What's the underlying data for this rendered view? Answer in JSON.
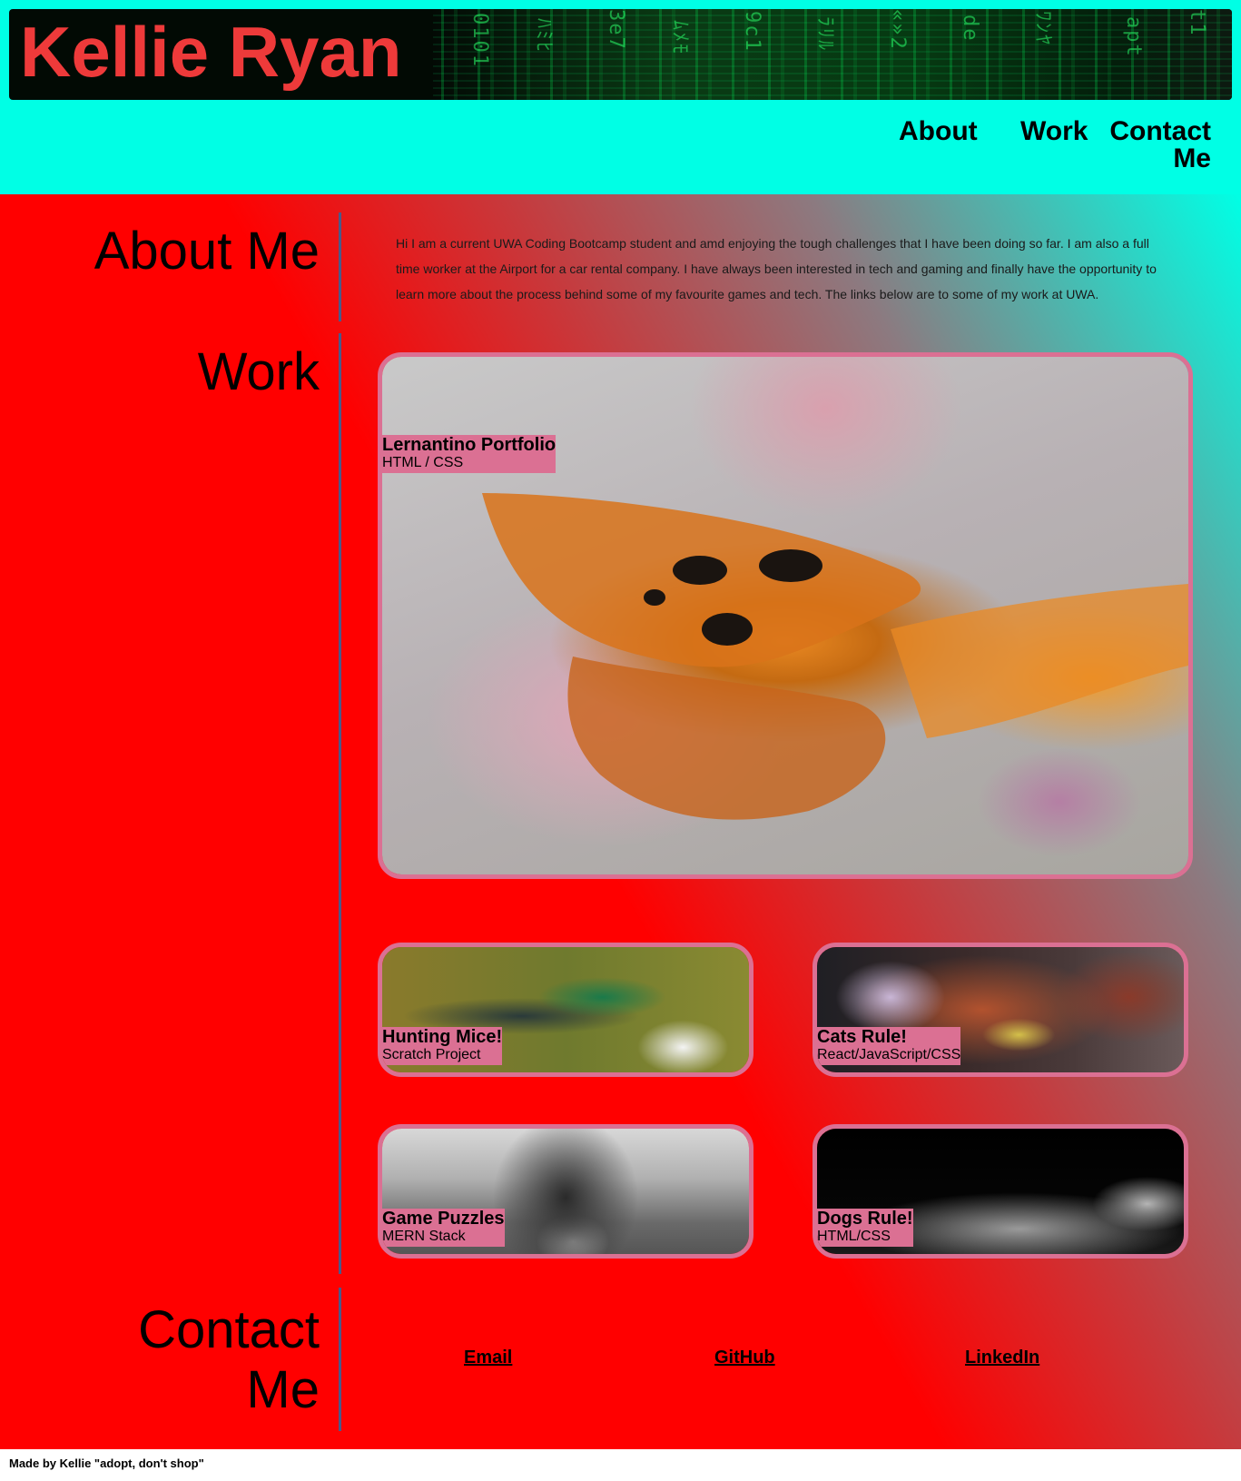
{
  "header": {
    "title": "Kellie Ryan",
    "title_color": "#ee3a3a",
    "background_color": "#00ffe5",
    "nav": {
      "about": "About",
      "work": "Work",
      "contact": "Contact Me"
    }
  },
  "about": {
    "heading": "About Me",
    "text": "Hi I am a current UWA Coding Bootcamp student and amd enjoying the tough challenges that I have been doing so far. I am also a full time worker at the Airport for a car rental company. I have always been interested in tech and gaming and finally have the opportunity to learn more about the process behind some of my favourite games and tech. The links below are to some of my work at UWA."
  },
  "work": {
    "heading": "Work",
    "card_border_color": "#db7093",
    "projects": [
      {
        "name": "Lernantino Portfolio",
        "tech": "HTML / CSS",
        "image": "butterfly-photo"
      },
      {
        "name": "Hunting Mice!",
        "tech": "Scratch Project",
        "image": "hummingbird-photo"
      },
      {
        "name": "Cats Rule!",
        "tech": "React/JavaScript/CSS",
        "image": "cat-photo"
      },
      {
        "name": "Game Puzzles",
        "tech": "MERN Stack",
        "image": "pony-photo"
      },
      {
        "name": "Dogs Rule!",
        "tech": "HTML/CSS",
        "image": "dog-photo"
      }
    ]
  },
  "contact": {
    "heading_line1": "Contact",
    "heading_line2": "Me",
    "links": {
      "email": "Email",
      "github": "GitHub",
      "linkedin": "LinkedIn"
    }
  },
  "footer": {
    "text": "Made by Kellie \"adopt, don't shop\""
  }
}
